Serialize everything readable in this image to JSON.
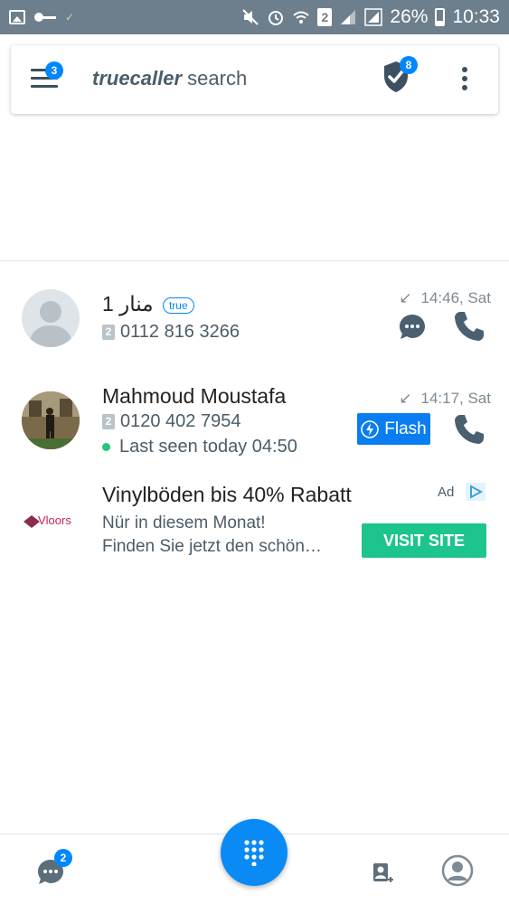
{
  "status_bar": {
    "battery": "26%",
    "time": "10:33",
    "sim_slot": "2"
  },
  "header": {
    "brand_prefix": "truecaller",
    "brand_suffix": " search",
    "menu_badge": "3",
    "shield_badge": "8"
  },
  "calls": [
    {
      "name": "منار 1",
      "badge": "true",
      "sim": "2",
      "number": "0112 816 3266",
      "time": "14:46, Sat"
    },
    {
      "name": "Mahmoud Moustafa",
      "sim": "2",
      "number": "0120 402 7954",
      "last_seen": "Last seen today 04:50",
      "time": "14:17, Sat",
      "flash_label": "Flash"
    }
  ],
  "ad": {
    "logo_text": "Vloors",
    "title": "Vinylböden bis 40% Rabatt",
    "line1": "Nür in diesem Monat!",
    "line2": "Finden Sie jetzt den schön…",
    "label": "Ad",
    "cta": "VISIT SITE"
  },
  "bottom_nav": {
    "messages_badge": "2"
  },
  "colors": {
    "status_bar": "#6d7f8c",
    "accent": "#0087ff",
    "cta_green": "#1ec48d",
    "online_dot": "#1fc87a"
  }
}
